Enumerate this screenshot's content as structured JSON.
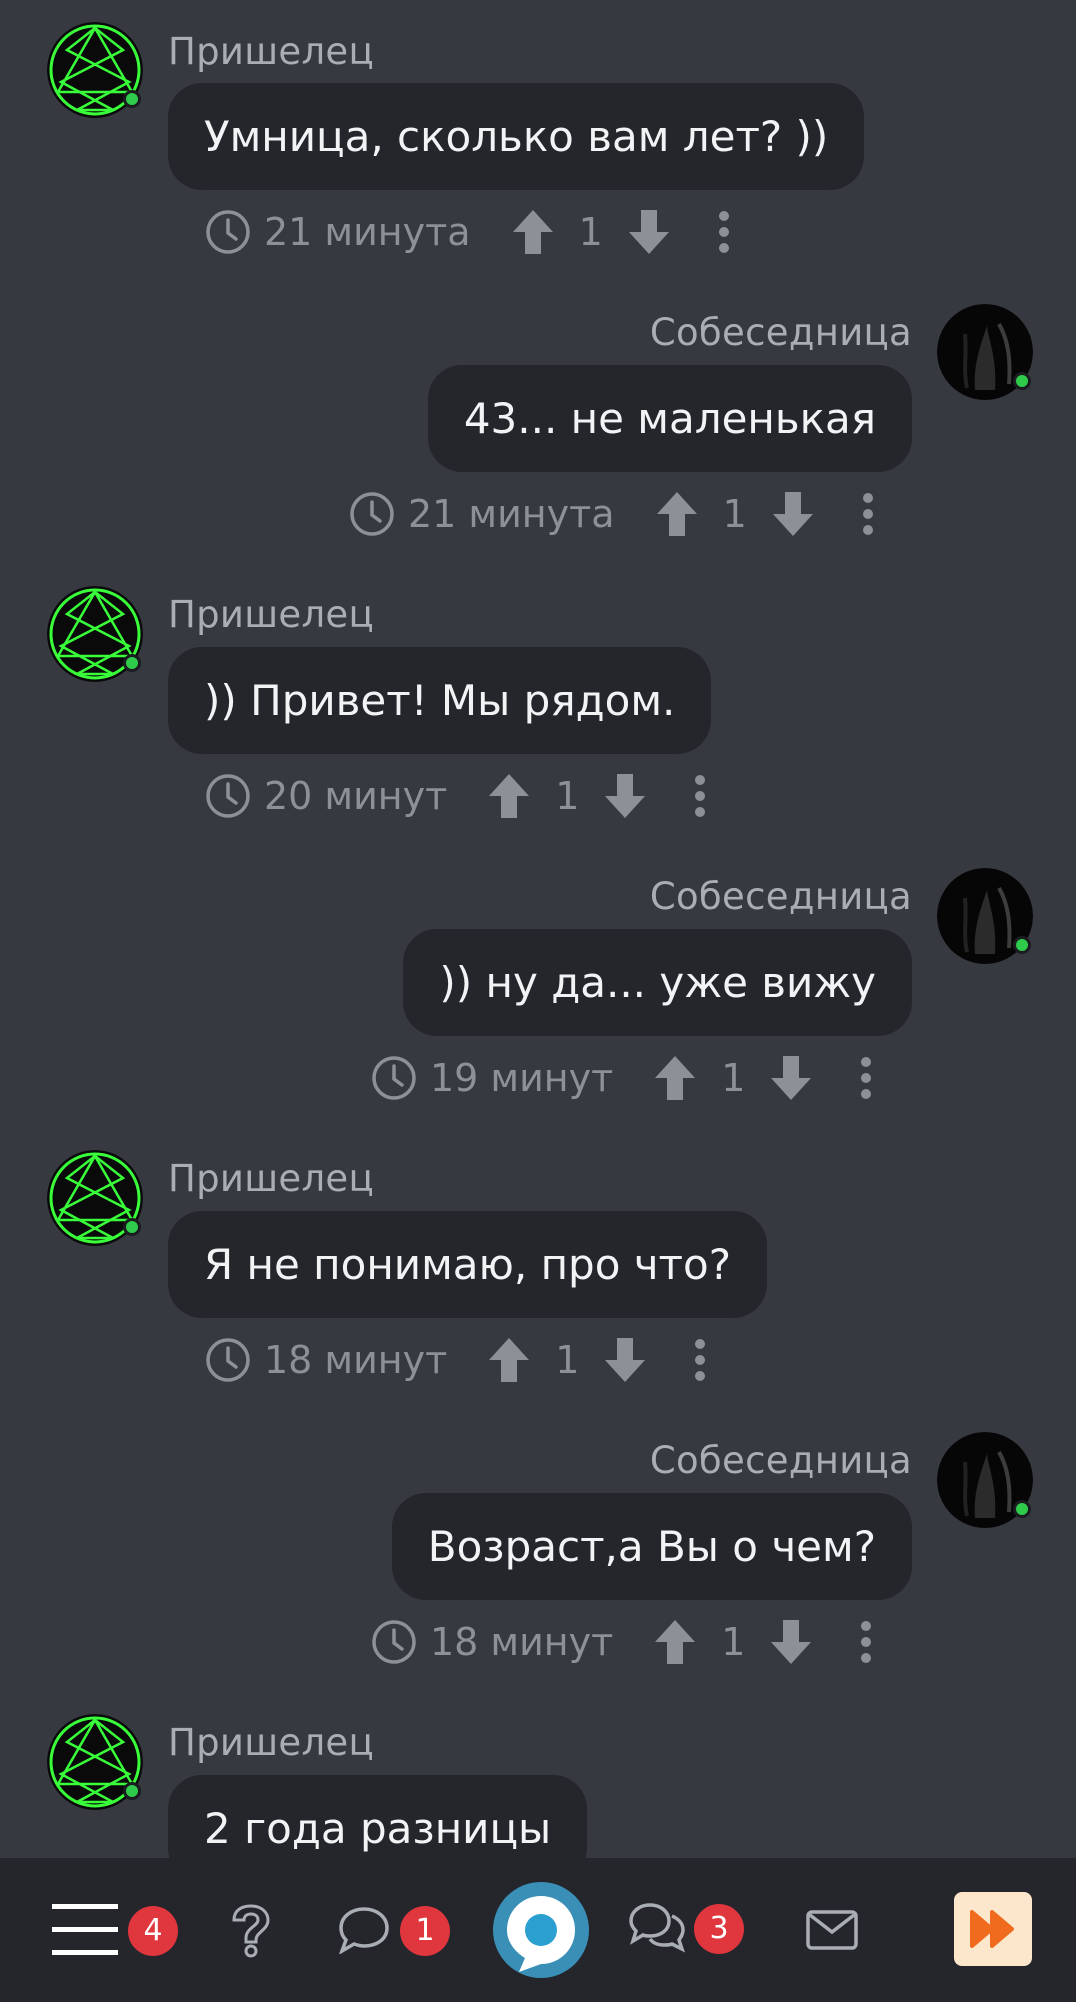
{
  "messages": [
    {
      "side": "left",
      "author": "Пришелец",
      "text": "Умница, сколько вам лет? ))",
      "time": "21 минута",
      "votes": "1"
    },
    {
      "side": "right",
      "author": "Собеседница",
      "text": "43... не маленькая",
      "time": "21 минута",
      "votes": "1"
    },
    {
      "side": "left",
      "author": "Пришелец",
      "text": ")) Привет! Мы рядом.",
      "time": "20 минут",
      "votes": "1"
    },
    {
      "side": "right",
      "author": "Собеседница",
      "text": ")) ну да... уже вижу",
      "time": "19 минут",
      "votes": "1"
    },
    {
      "side": "left",
      "author": "Пришелец",
      "text": "Я не понимаю, про что?",
      "time": "18 минут",
      "votes": "1"
    },
    {
      "side": "right",
      "author": "Собеседница",
      "text": "Возраст,а Вы о чем?",
      "time": "18 минут",
      "votes": "1"
    },
    {
      "side": "left",
      "author": "Пришелец",
      "text": "2 года разницы",
      "time": "",
      "votes": ""
    }
  ],
  "bottom_bar": {
    "menu_badge": "4",
    "comments_badge": "1",
    "discussions_badge": "3",
    "icons": [
      "menu-icon",
      "help-icon",
      "comment-icon",
      "app-logo",
      "discussions-icon",
      "mail-icon",
      "fast-forward-icon"
    ]
  },
  "colors": {
    "background": "#363940",
    "bubble": "#24262b",
    "online": "#2ecc4a",
    "badge": "#e0363e",
    "logo": "#3a8fb7",
    "fast_forward_bg": "#fde7cc",
    "fast_forward_fg": "#f06b1d"
  }
}
